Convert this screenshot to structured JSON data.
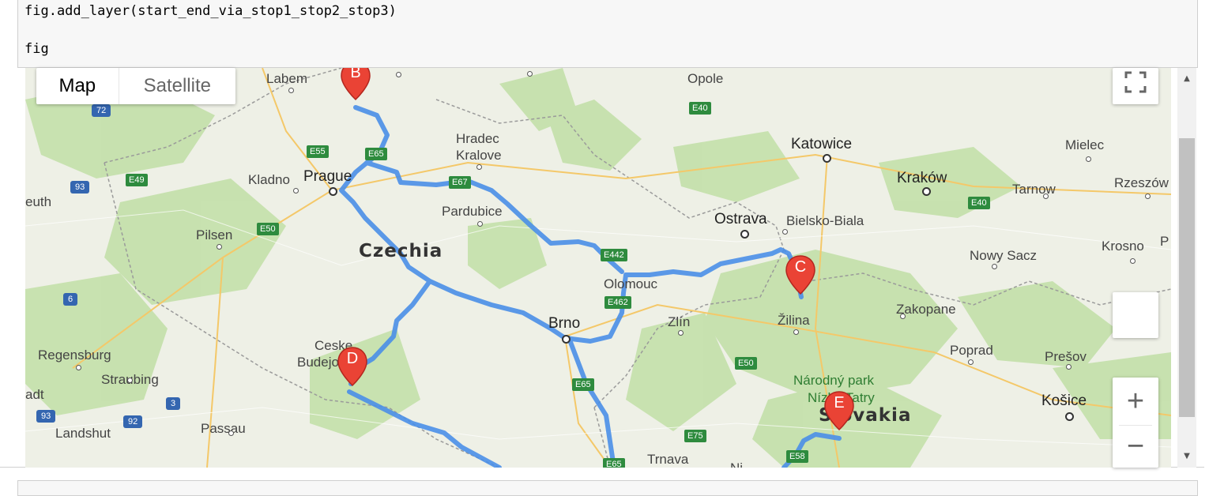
{
  "code": {
    "lines": [
      "fig.add_layer(start_end_via_stop1_stop2_stop3)",
      "",
      "fig"
    ]
  },
  "map_type": {
    "map_label": "Map",
    "satellite_label": "Satellite",
    "active": "Map"
  },
  "controls": {
    "fullscreen_icon": "fullscreen-icon",
    "zoom_in": "+",
    "zoom_out": "−"
  },
  "markers": {
    "b": "B",
    "c": "C",
    "d": "D",
    "e": "E"
  },
  "places": {
    "labem": "Labem",
    "opole": "Opole",
    "hradec1": "Hradec",
    "hradec2": "Kralove",
    "katowice": "Katowice",
    "mielec": "Mielec",
    "krakow": "Kraków",
    "tarnow": "Tarnow",
    "rzeszow": "Rzeszów",
    "kladno": "Kladno",
    "prague": "Prague",
    "pardubice": "Pardubice",
    "ostrava": "Ostrava",
    "bielsko": "Bielsko-Biala",
    "euth": "euth",
    "pilsen": "Pilsen",
    "czechia": "Czechia",
    "nowy_sacz": "Nowy Sacz",
    "krosno": "Krosno",
    "p": "P",
    "olomouc": "Olomouc",
    "zakopane": "Zakopane",
    "brno": "Brno",
    "zlin": "Zlín",
    "zilina": "Žilina",
    "ceske1": "Ceske",
    "ceske2": "Budejovice",
    "regensburg": "Regensburg",
    "poprad": "Poprad",
    "presov": "Prešov",
    "straubing": "Straubing",
    "park1": "Národný park",
    "park2": "Nízke Tatry",
    "adt": "adt",
    "kosice": "Košice",
    "slovakia": "Slovakia",
    "landshut": "Landshut",
    "passau": "Passau",
    "trnava": "Trnava",
    "ni": "Ni"
  },
  "roads": {
    "e72": "72",
    "e40a": "E40",
    "e55": "E55",
    "e65a": "E65",
    "e49": "E49",
    "e93a": "93",
    "e67": "E67",
    "e40b": "E40",
    "e50a": "E50",
    "e442": "E442",
    "e6": "6",
    "e462": "E462",
    "e50b": "E50",
    "e65b": "E65",
    "e93b": "93",
    "e92": "92",
    "e3": "3",
    "e75": "E75",
    "e65c": "E65",
    "e58": "E58"
  },
  "colors": {
    "route": "#4a8fe8",
    "marker": "#ea4335",
    "road_green": "#2e8b3e",
    "road_blue": "#3466b0",
    "forest": "#b9dca0"
  }
}
